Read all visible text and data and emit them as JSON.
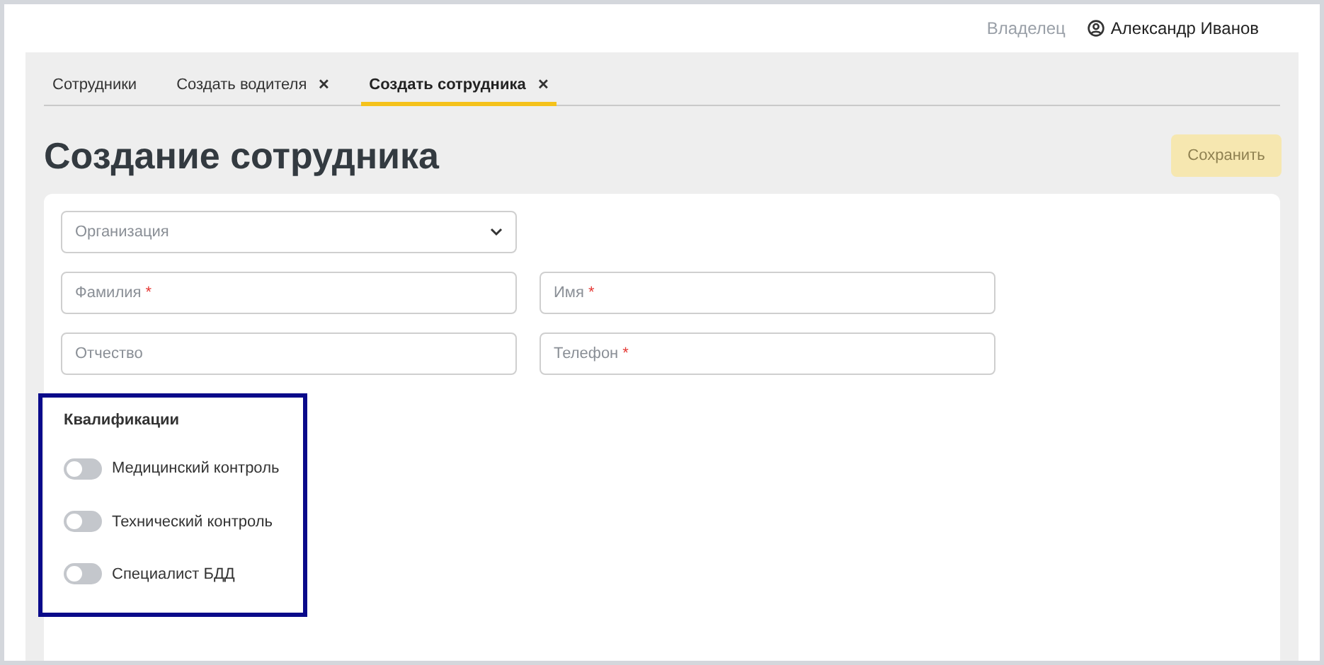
{
  "header": {
    "role": "Владелец",
    "user": "Александр Иванов"
  },
  "tabs": [
    {
      "label": "Сотрудники",
      "closable": false,
      "selected": false
    },
    {
      "label": "Создать водителя",
      "closable": true,
      "selected": false
    },
    {
      "label": "Создать сотрудника",
      "closable": true,
      "selected": true
    }
  ],
  "close_glyph": "✕",
  "page_title": "Создание сотрудника",
  "save_button": {
    "label": "Сохранить",
    "disabled": true
  },
  "fields": [
    [
      {
        "kind": "select",
        "placeholder": "Организация",
        "required": false
      }
    ],
    [
      {
        "kind": "text",
        "placeholder": "Фамилия",
        "required": true
      },
      {
        "kind": "text",
        "placeholder": "Имя",
        "required": true
      }
    ],
    [
      {
        "kind": "text",
        "placeholder": "Отчество",
        "required": false
      },
      {
        "kind": "text",
        "placeholder": "Телефон",
        "required": true
      }
    ]
  ],
  "required_mark": "*",
  "qualifications": {
    "title": "Квалификации",
    "highlighted": true,
    "items": [
      {
        "label": "Медицинский контроль",
        "on": false
      },
      {
        "label": "Технический контроль",
        "on": false
      },
      {
        "label": "Специалист БДД",
        "on": false
      }
    ]
  }
}
